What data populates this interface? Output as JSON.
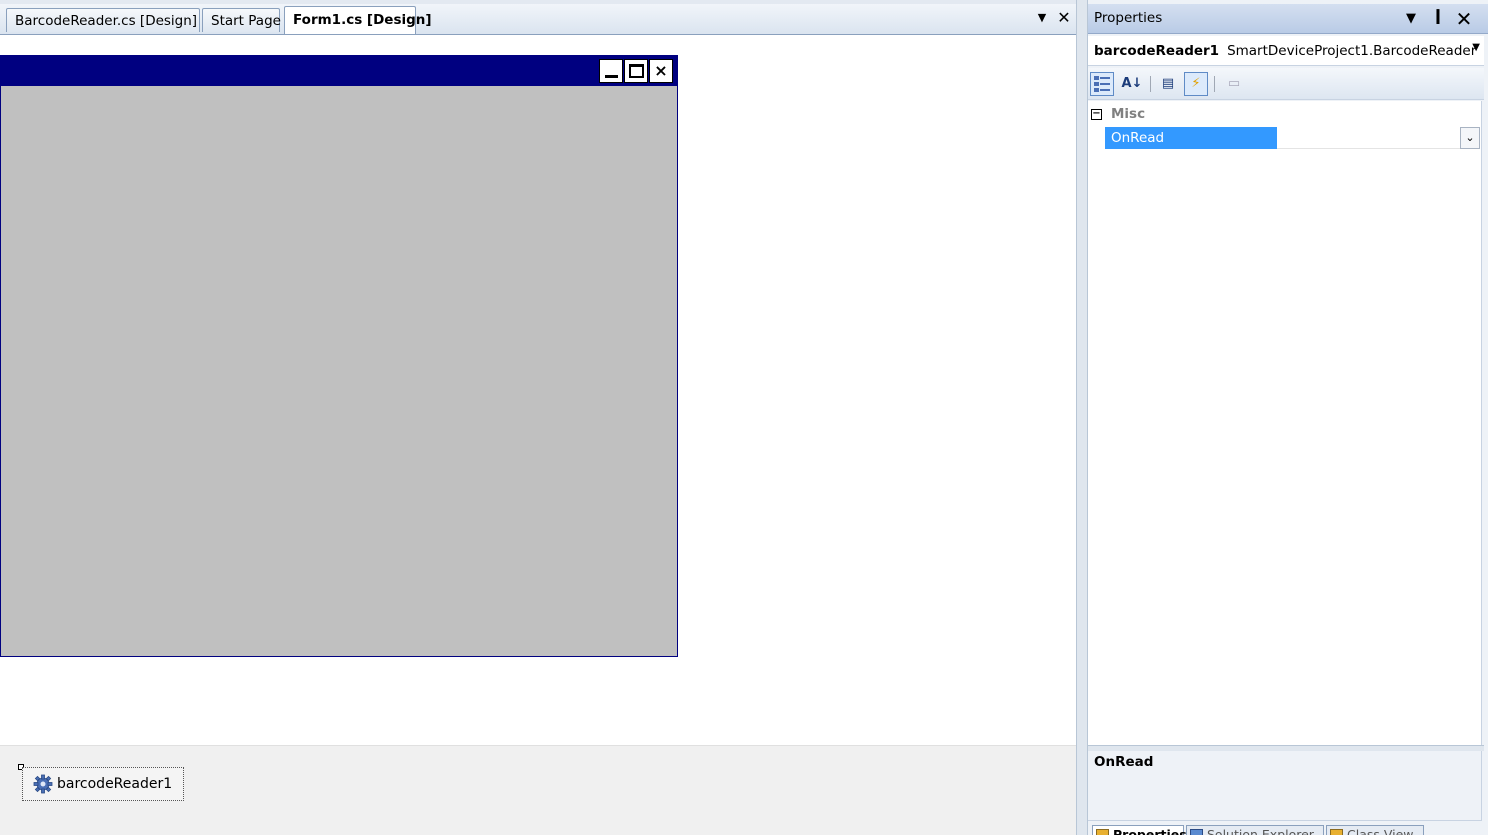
{
  "document_tabs": [
    {
      "label": "BarcodeReader.cs [Design]",
      "active": false
    },
    {
      "label": "Start Page",
      "active": false
    },
    {
      "label": "Form1.cs [Design]",
      "active": true
    }
  ],
  "document_controls": {
    "menu_icon": "dropdown-arrow-icon",
    "close_icon": "close-icon"
  },
  "form": {
    "caption_buttons": [
      "minimize",
      "maximize",
      "close"
    ],
    "close_glyph": "×"
  },
  "component_tray": {
    "item_label": "barcodeReader1",
    "item_icon": "gear-icon"
  },
  "properties": {
    "title": "Properties",
    "object_name": "barcodeReader1",
    "object_type": "SmartDeviceProject1.BarcodeReader",
    "toolbar": [
      "categorized",
      "alphabetical",
      "properties",
      "events",
      "property-pages"
    ],
    "active_toolbar": "events",
    "category": {
      "toggle": "⊟",
      "label": "Misc"
    },
    "selected_property": {
      "name": "OnRead",
      "value": ""
    },
    "description": {
      "title": "OnRead",
      "text": ""
    },
    "bottom_tabs": [
      "Properties",
      "Solution Explorer",
      "Class View"
    ]
  },
  "colors": {
    "form_caption": "#000080",
    "form_client": "#c0c0c0",
    "selection": "#3399ff"
  }
}
